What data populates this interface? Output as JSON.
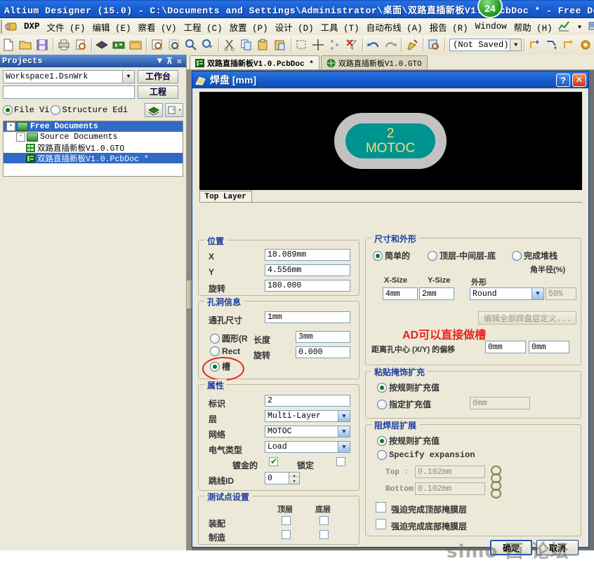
{
  "window": {
    "title": "Altium Designer (15.0) - C:\\Documents and Settings\\Administrator\\桌面\\双路直插新板V1.0.PcbDoc * - Free Docu",
    "badge": "24"
  },
  "menubar": {
    "items": [
      "DXP",
      "文件 (F)",
      "编辑 (E)",
      "察看 (V)",
      "工程 (C)",
      "放置 (P)",
      "设计 (D)",
      "工具 (T)",
      "自动布线 (A)",
      "报告 (R)",
      "Window",
      "帮助 (H)"
    ]
  },
  "toolbar": {
    "saved_state": "(Not Saved)"
  },
  "panel": {
    "title": "Projects",
    "workspace": "Workspace1.DsnWrk",
    "project_value": "",
    "buttons": {
      "workbench": "工作台",
      "project": "工程"
    },
    "view_modes": [
      {
        "label": "File Vi",
        "selected": true
      },
      {
        "label": "Structure Edi",
        "selected": false
      }
    ],
    "tree": [
      {
        "label": "Free Documents",
        "level": 1,
        "selected": true,
        "expander": "-",
        "icon": "folder-icon"
      },
      {
        "label": "Source Documents",
        "level": 2,
        "selected": false,
        "expander": "-",
        "icon": "folder-icon"
      },
      {
        "label": "双路直插新板V1.0.GTO",
        "level": 3,
        "selected": false,
        "expander": "",
        "icon": "gerber-doc-icon"
      },
      {
        "label": "双路直插新板V1.0.PcbDoc *",
        "level": 3,
        "selected": true,
        "expander": "",
        "icon": "pcb-doc-icon"
      }
    ]
  },
  "doc_tabs": [
    {
      "label": "双路直插新板V1.0.PcbDoc *",
      "active": true,
      "icon": "pcb-doc-icon"
    },
    {
      "label": "双路直插新板V1.0.GTO",
      "active": false,
      "icon": "gerber-doc-icon"
    }
  ],
  "dialog": {
    "title": "焊盘  [mm]",
    "help_label": "?",
    "close_label": "✕",
    "preview": {
      "designator": "2",
      "net": "MOTOC",
      "pad_color": "#009490",
      "mask_color": "#c2c2c2",
      "text_color": "#ffd77a",
      "background": "#000000",
      "layer_tab": "Top Layer"
    },
    "position": {
      "legend": "位置",
      "x_label": "X",
      "x_value": "18.089mm",
      "y_label": "Y",
      "y_value": "4.556mm",
      "rot_label": "旋转",
      "rot_value": "180.000"
    },
    "hole": {
      "legend": "孔洞信息",
      "size_label": "通孔尺寸",
      "size_value": "1mm",
      "shapes": [
        {
          "label": "圆形(R",
          "selected": false
        },
        {
          "label": "Rect",
          "selected": false
        },
        {
          "label": "槽",
          "selected": true
        }
      ],
      "length_label": "长度",
      "length_value": "3mm",
      "rot_label": "旋转",
      "rot_value": "0.000"
    },
    "properties": {
      "legend": "属性",
      "designator_label": "标识",
      "designator_value": "2",
      "layer_label": "层",
      "layer_value": "Multi-Layer",
      "net_label": "网络",
      "net_value": "MOTOC",
      "electrical_label": "电气类型",
      "electrical_value": "Load",
      "plated_label": "镀金的",
      "plated_checked": true,
      "locked_label": "锁定",
      "locked_checked": false,
      "jumper_label": "跳线ID",
      "jumper_value": "0"
    },
    "testpoint": {
      "legend": "测试点设置",
      "col_top": "顶层",
      "col_bottom": "底层",
      "rows": [
        {
          "label": "装配",
          "top": false,
          "bottom": false
        },
        {
          "label": "制造",
          "top": false,
          "bottom": false
        }
      ]
    },
    "size_shape": {
      "legend": "尺寸和外形",
      "modes": [
        {
          "label": "简单的",
          "selected": true
        },
        {
          "label": "顶层-中间层-底",
          "selected": false
        },
        {
          "label": "完成堆栈",
          "selected": false
        }
      ],
      "corner_radius_label": "角半径(%)",
      "col_x": "X-Size",
      "col_y": "Y-Size",
      "col_shape": "外形",
      "x_value": "4mm",
      "y_value": "2mm",
      "shape_value": "Round",
      "corner_radius_value": "50%",
      "edit_all_button": "编辑全部焊盘层定义...",
      "offset_label": "距离孔中心 (X/Y) 的偏移",
      "offset_x": "0mm",
      "offset_y": "0mm"
    },
    "paste_mask": {
      "legend": "粘贴掩饰扩充",
      "rule_label": "按规则扩充值",
      "rule_selected": true,
      "specify_label": "指定扩充值",
      "specify_selected": false,
      "specify_value": "0mm"
    },
    "solder_mask": {
      "legend": "阻焊层扩展",
      "rule_label": "按规则扩充值",
      "rule_selected": true,
      "specify_label": "Specify expansion",
      "specify_selected": false,
      "top_label": "Top :",
      "top_value": "0.102mm",
      "bottom_label": "Bottom",
      "bottom_value": "0.102mm",
      "force_top_label": "强迫完成顶部掩膜层",
      "force_top_checked": false,
      "force_bottom_label": "强迫完成底部掩膜层",
      "force_bottom_checked": false
    },
    "footer": {
      "ok": "确定",
      "cancel": "取消"
    },
    "annotation": "AD可以直接做槽",
    "watermark": "simo   西  论坛"
  }
}
